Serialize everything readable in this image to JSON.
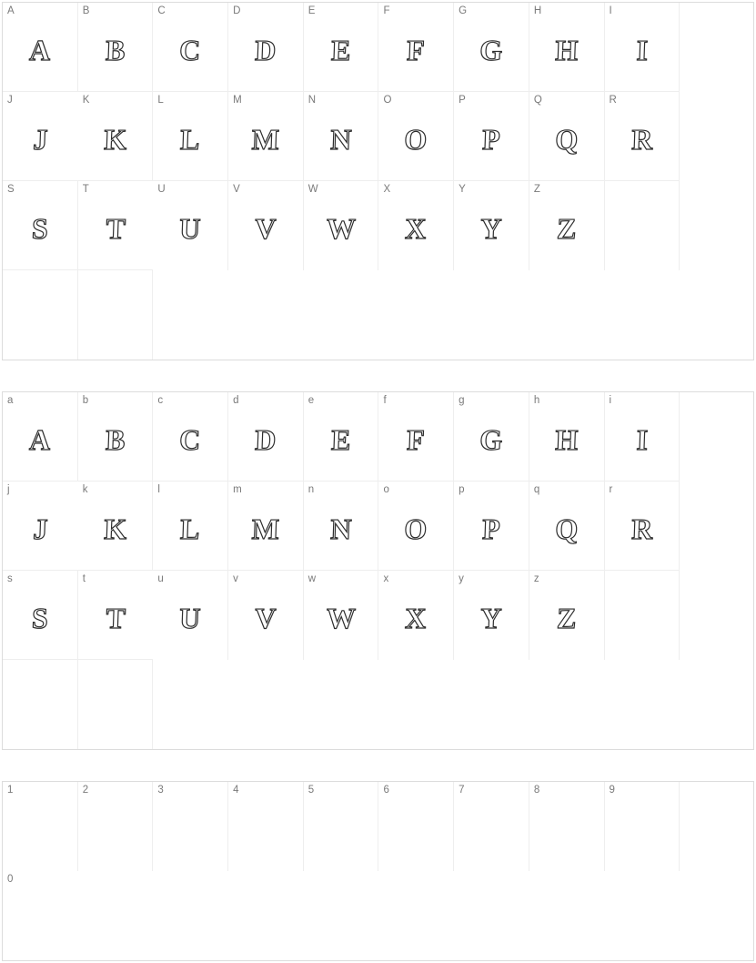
{
  "sections": [
    {
      "id": "uppercase",
      "rows": 3,
      "cells": [
        {
          "label": "A",
          "glyph": "A"
        },
        {
          "label": "B",
          "glyph": "B"
        },
        {
          "label": "C",
          "glyph": "C"
        },
        {
          "label": "D",
          "glyph": "D"
        },
        {
          "label": "E",
          "glyph": "E"
        },
        {
          "label": "F",
          "glyph": "F"
        },
        {
          "label": "G",
          "glyph": "G"
        },
        {
          "label": "H",
          "glyph": "H"
        },
        {
          "label": "I",
          "glyph": "I"
        },
        {
          "label": "J",
          "glyph": "J"
        },
        {
          "label": "K",
          "glyph": "K"
        },
        {
          "label": "L",
          "glyph": "L"
        },
        {
          "label": "M",
          "glyph": "M"
        },
        {
          "label": "N",
          "glyph": "N"
        },
        {
          "label": "O",
          "glyph": "O"
        },
        {
          "label": "P",
          "glyph": "P"
        },
        {
          "label": "Q",
          "glyph": "Q"
        },
        {
          "label": "R",
          "glyph": "R"
        },
        {
          "label": "S",
          "glyph": "S"
        },
        {
          "label": "T",
          "glyph": "T"
        },
        {
          "label": "U",
          "glyph": "U"
        },
        {
          "label": "V",
          "glyph": "V"
        },
        {
          "label": "W",
          "glyph": "W"
        },
        {
          "label": "X",
          "glyph": "X"
        },
        {
          "label": "Y",
          "glyph": "Y"
        },
        {
          "label": "Z",
          "glyph": "Z"
        },
        {
          "label": "",
          "glyph": "",
          "empty": true
        },
        {
          "label": "",
          "glyph": "",
          "empty": true
        },
        {
          "label": "",
          "glyph": "",
          "empty": true
        },
        {
          "label": "",
          "glyph": "",
          "empty": true
        }
      ]
    },
    {
      "id": "lowercase",
      "rows": 3,
      "cells": [
        {
          "label": "a",
          "glyph": "A"
        },
        {
          "label": "b",
          "glyph": "B"
        },
        {
          "label": "c",
          "glyph": "C"
        },
        {
          "label": "d",
          "glyph": "D"
        },
        {
          "label": "e",
          "glyph": "E"
        },
        {
          "label": "f",
          "glyph": "F"
        },
        {
          "label": "g",
          "glyph": "G"
        },
        {
          "label": "h",
          "glyph": "H"
        },
        {
          "label": "i",
          "glyph": "I"
        },
        {
          "label": "j",
          "glyph": "J"
        },
        {
          "label": "k",
          "glyph": "K"
        },
        {
          "label": "l",
          "glyph": "L"
        },
        {
          "label": "m",
          "glyph": "M"
        },
        {
          "label": "n",
          "glyph": "N"
        },
        {
          "label": "o",
          "glyph": "O"
        },
        {
          "label": "p",
          "glyph": "P"
        },
        {
          "label": "q",
          "glyph": "Q"
        },
        {
          "label": "r",
          "glyph": "R"
        },
        {
          "label": "s",
          "glyph": "S"
        },
        {
          "label": "t",
          "glyph": "T"
        },
        {
          "label": "u",
          "glyph": "U"
        },
        {
          "label": "v",
          "glyph": "V"
        },
        {
          "label": "w",
          "glyph": "W"
        },
        {
          "label": "x",
          "glyph": "X"
        },
        {
          "label": "y",
          "glyph": "Y"
        },
        {
          "label": "z",
          "glyph": "Z"
        },
        {
          "label": "",
          "glyph": "",
          "empty": true
        },
        {
          "label": "",
          "glyph": "",
          "empty": true
        },
        {
          "label": "",
          "glyph": "",
          "empty": true
        },
        {
          "label": "",
          "glyph": "",
          "empty": true
        }
      ]
    },
    {
      "id": "digits",
      "rows": 1,
      "cells": [
        {
          "label": "1",
          "glyph": ""
        },
        {
          "label": "2",
          "glyph": ""
        },
        {
          "label": "3",
          "glyph": ""
        },
        {
          "label": "4",
          "glyph": ""
        },
        {
          "label": "5",
          "glyph": ""
        },
        {
          "label": "6",
          "glyph": ""
        },
        {
          "label": "7",
          "glyph": ""
        },
        {
          "label": "8",
          "glyph": ""
        },
        {
          "label": "9",
          "glyph": ""
        },
        {
          "label": "0",
          "glyph": ""
        }
      ]
    }
  ]
}
